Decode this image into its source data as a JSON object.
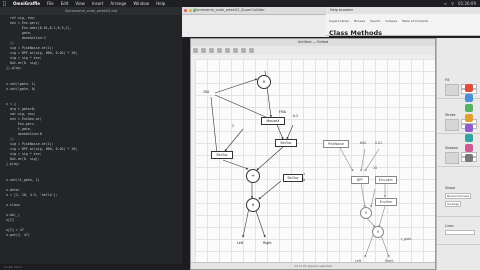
{
  "menubar": {
    "app": "OmniGraffle",
    "items": [
      "File",
      "Edit",
      "View",
      "Insert",
      "Arrange",
      "Window",
      "Help"
    ],
    "clock": "01:26:09"
  },
  "editor": {
    "title": "Somename_code_week02.md",
    "lines": [
      [
        "plain",
        "  ref sig, env;"
      ],
      [
        "plain",
        "  env = Env.perc("
      ],
      [
        "plain",
        "        Env.adsr(0.01,0.1,0.5,1),"
      ],
      [
        "plain",
        "        gate,"
      ],
      [
        "plain",
        "        doneAction:2"
      ],
      [
        "plain",
        "  );"
      ],
      [
        "plain",
        "  sig = PinkNoise.ar(1);"
      ],
      [
        "plain",
        "  sig = BPF.ar(sig, 600, 0.02) * 20;"
      ],
      [
        "plain",
        "  sig = sig * env;"
      ],
      [
        "plain",
        "  Out.ar(0, sig);"
      ],
      [
        "plain",
        "}).play;"
      ],
      [
        "plain",
        ""
      ],
      [
        "plain",
        ""
      ],
      [
        "plain",
        "x.set(\\gate, 1)"
      ],
      [
        "plain",
        "x.set(\\gate, 0)"
      ],
      [
        "plain",
        ""
      ],
      [
        "plain",
        ""
      ],
      [
        "plain",
        "x = {"
      ],
      [
        "plain",
        "  arg t_gate=0;"
      ],
      [
        "plain",
        "  var sig, env;"
      ],
      [
        "plain",
        "  env = EnvGen.ar("
      ],
      [
        "plain",
        "      Env.perc,"
      ],
      [
        "plain",
        "      t_gate,"
      ],
      [
        "plain",
        "      doneAction:0"
      ],
      [
        "plain",
        "  );"
      ],
      [
        "plain",
        "  sig = PinkNoise.ar(1);"
      ],
      [
        "plain",
        "  sig = BPF.ar(sig, 600, 0.02) * 20;"
      ],
      [
        "plain",
        "  sig = sig * env;"
      ],
      [
        "plain",
        "  Out.ar(0, sig);"
      ],
      [
        "plain",
        "}.play;"
      ],
      [
        "plain",
        ""
      ],
      [
        "plain",
        ""
      ],
      [
        "plain",
        "x.set(\\t_gate, 1)"
      ],
      [
        "plain",
        ""
      ],
      [
        "plain",
        "s.meter"
      ],
      [
        "plain",
        "x = [1, 20, 4.5, 'hello'];"
      ],
      [
        "plain",
        ""
      ],
      [
        "plain",
        "x.class"
      ],
      [
        "plain",
        ""
      ],
      [
        "plain",
        "x.do(_)"
      ],
      [
        "plain",
        "x[2]"
      ],
      [
        "plain",
        ""
      ],
      [
        "plain",
        "x[2] = 47"
      ],
      [
        "plain",
        "x.put(2, 47)"
      ]
    ],
    "status": "Ln 44, Col 1"
  },
  "bgwin": {
    "title": "Somename_code_week02_SuperCollider"
  },
  "help": {
    "window_title": "Help browser",
    "tabs": [
      "SuperCollider",
      "Browse",
      "Search",
      "Indexes",
      "Table of Contents"
    ],
    "title": "Class Methods"
  },
  "diagram": {
    "window_title": "Untitled — Edited",
    "footer": "14 of 24 objects selected",
    "labels": {
      "n200": "200",
      "fma": "FMA",
      "mouse": "MouseX",
      "n2a": "2",
      "n02": "0.2",
      "sinosc1": "SinOsc",
      "sinosc2": "SinOsc",
      "sinosc3": "SinOsc",
      "left": "Left",
      "right": "Right",
      "one": "1",
      "zero": "0",
      "pinknoise": "PinkNoise",
      "n600": "600",
      "n002": "0.02",
      "bpf": "BPF",
      "n20": "20",
      "envperc": "Env.perc",
      "envgen": "EnvGen",
      "tgate": "t_gate",
      "left2": "Left",
      "right2": "Right"
    }
  },
  "inspector": {
    "sections": [
      "Fill",
      "Stroke",
      "Shadow",
      "Shape",
      "Lines"
    ],
    "shape_option": "Round Corners",
    "note": "Arrange"
  },
  "colors": {
    "accent": "#3b5bdb",
    "dock": [
      "#e24b3c",
      "#4a90d9",
      "#58b368",
      "#e0a030",
      "#8e5bd0",
      "#2fa4a0",
      "#d05b8e",
      "#777777"
    ]
  }
}
